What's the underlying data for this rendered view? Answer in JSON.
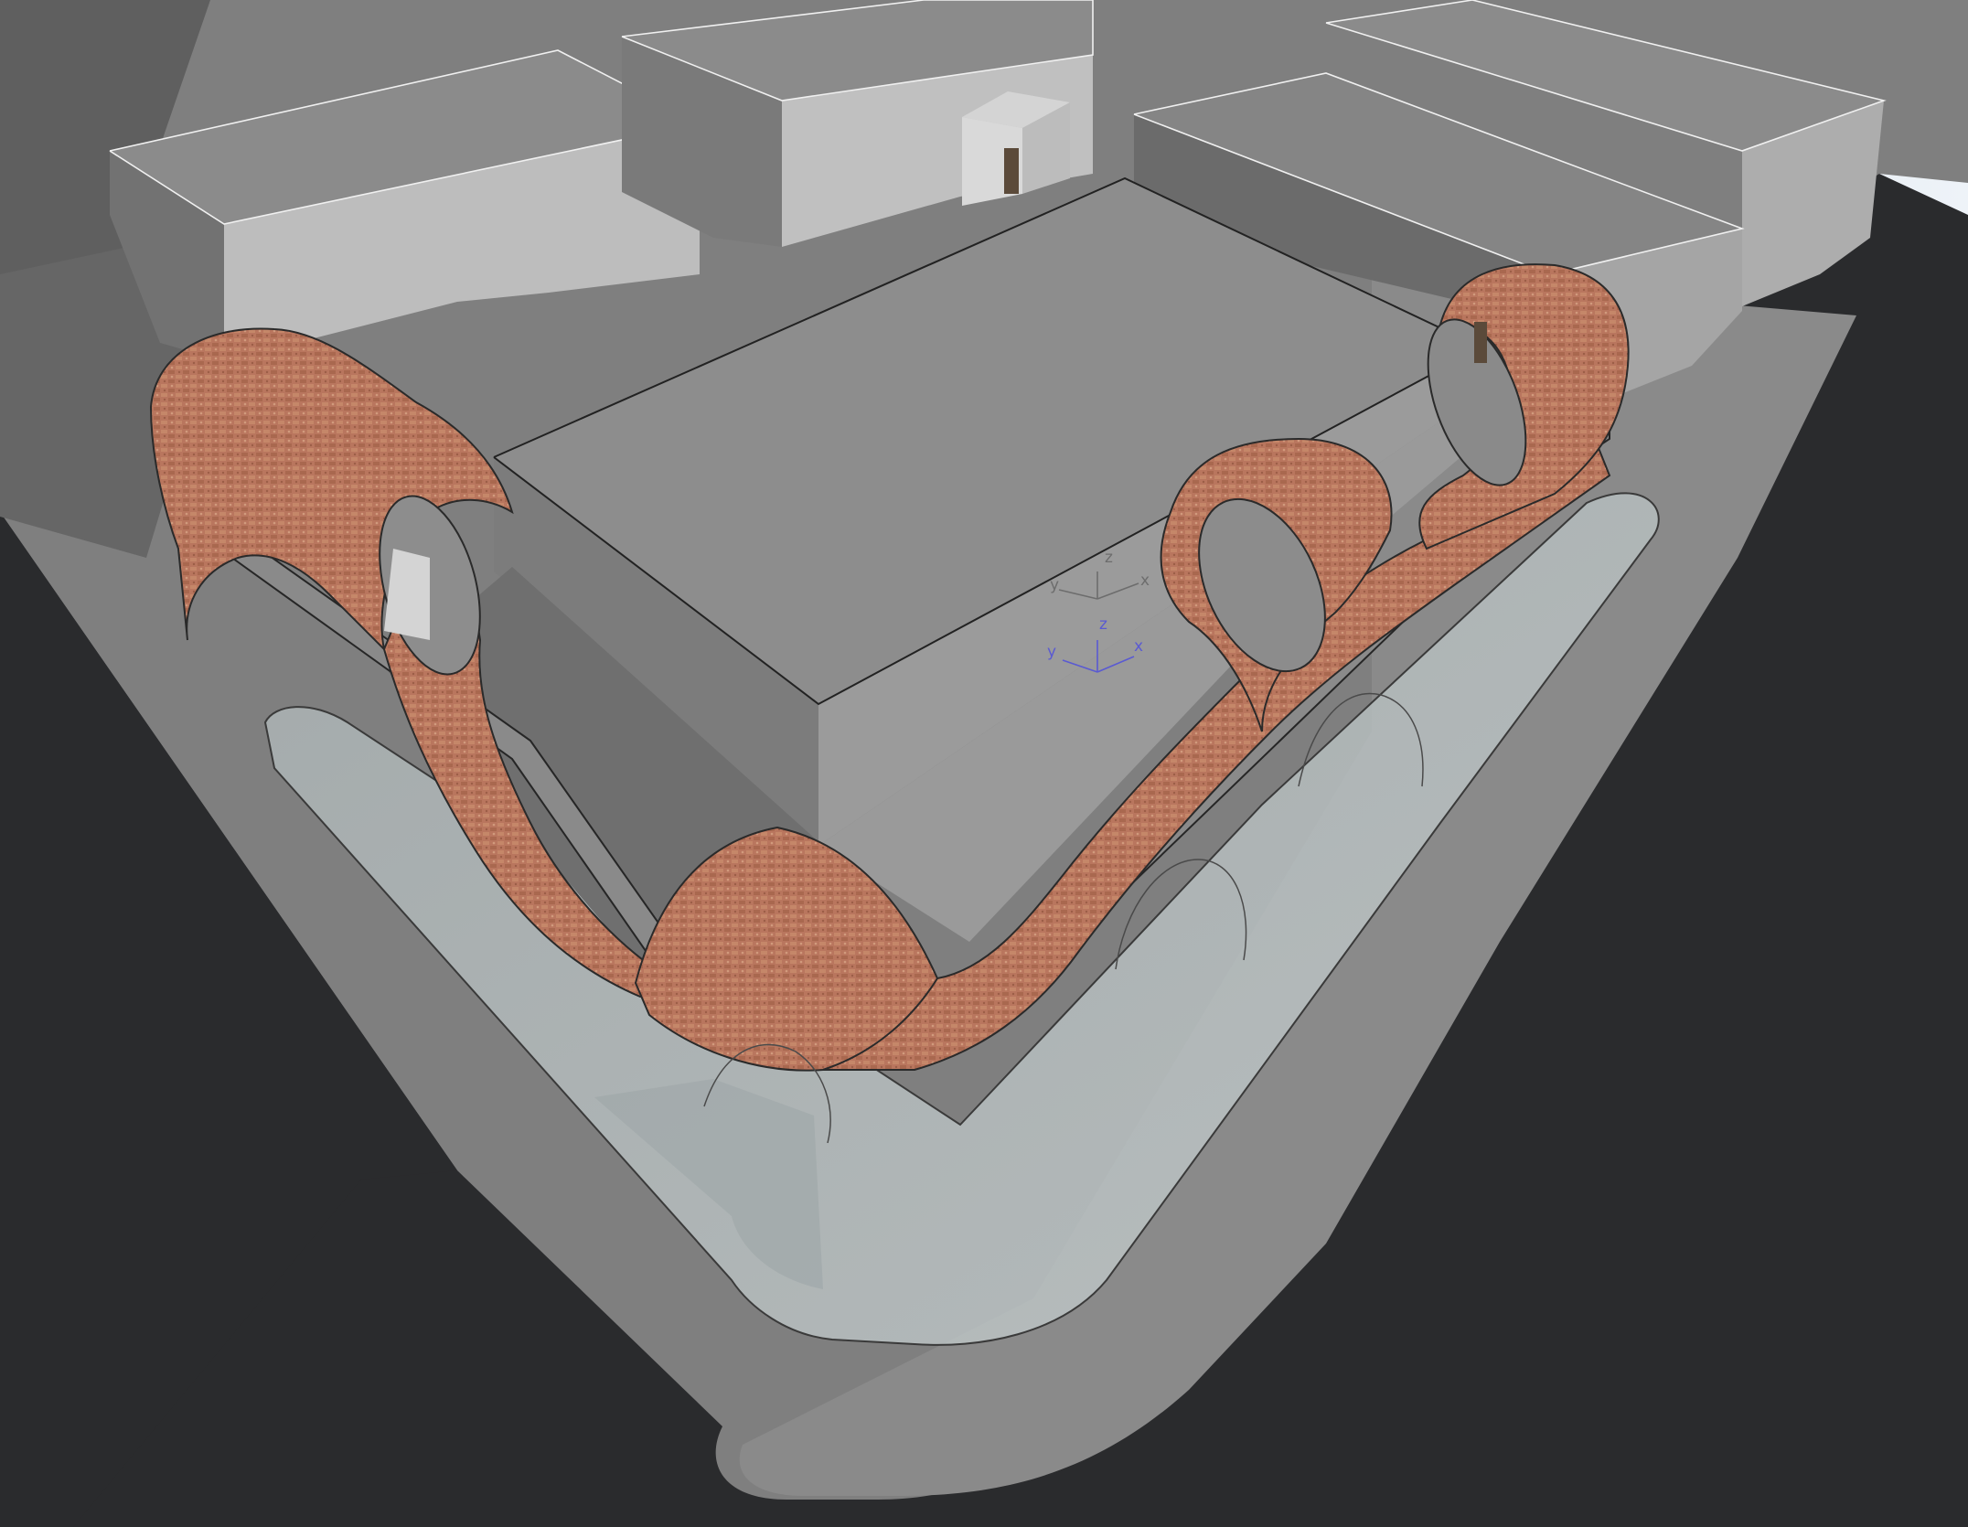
{
  "viewport": {
    "sky_color": "#e6edf4",
    "ground_color": "#2a2b2d",
    "plaza_color": "#7e7e7e",
    "shadow_color": "#5a5a5a",
    "brick_color": "#b9765e",
    "glass_color": "#b3bcbd"
  },
  "axes": [
    {
      "x": "x",
      "y": "y",
      "z": "z",
      "color": "#6d6d6d"
    },
    {
      "x": "x",
      "y": "y",
      "z": "z",
      "color": "#5a5ad2"
    }
  ]
}
